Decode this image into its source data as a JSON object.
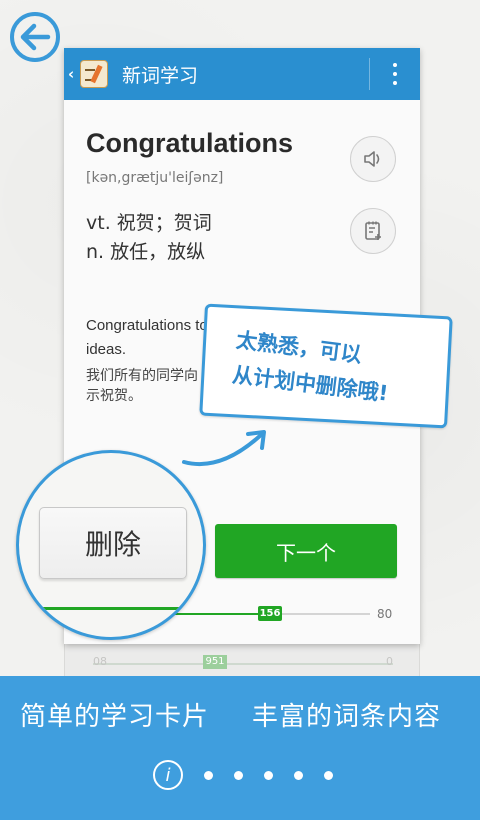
{
  "colors": {
    "accent": "#2a8fd0",
    "green": "#21a624",
    "banner": "#3f9ede"
  },
  "appbar": {
    "title": "新词学习",
    "back_icon": "chevron-left-icon",
    "menu_icon": "overflow-menu-icon"
  },
  "card": {
    "word": "Congratulations",
    "phonetic": "[kən,grætju'leiʃənz]",
    "definitions": [
      "vt. 祝贺；贺词",
      "n. 放任，放纵"
    ],
    "example_en": "Congratulations to everybody who sent in their ideas.",
    "example_zh": "我们所有的同学向\n示祝贺。",
    "next_label": "下一个",
    "progress": {
      "current": "156",
      "total": "80",
      "fraction": 0.5
    }
  },
  "ghost_card": {
    "left": "08",
    "badge": "951",
    "right": "0"
  },
  "bubble": {
    "line1": "太熟悉，可以",
    "line2": "从计划中删除哦!"
  },
  "magnifier": {
    "button_label": "删除"
  },
  "banner": {
    "left": "简单的学习卡片",
    "right": "丰富的词条内容",
    "pager_current": "i",
    "page_count": 6
  }
}
